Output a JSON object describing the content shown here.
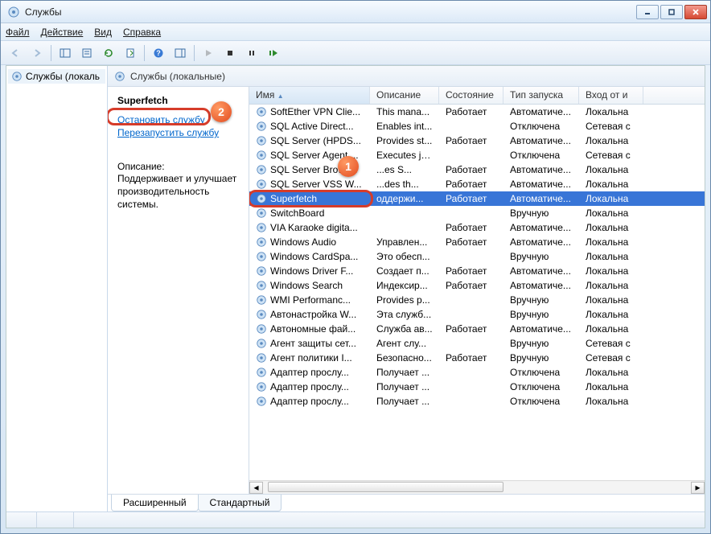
{
  "window": {
    "title": "Службы"
  },
  "menu": {
    "file": "Файл",
    "action": "Действие",
    "view": "Вид",
    "help": "Справка"
  },
  "tree": {
    "root": "Службы (локаль"
  },
  "header": {
    "title": "Службы (локальные)"
  },
  "detail": {
    "name": "Superfetch",
    "stop": "Остановить службу",
    "restart": "Перезапустить службу",
    "desc_label": "Описание:",
    "desc_text": "Поддерживает и улучшает производительность системы."
  },
  "columns": {
    "name": "Имя",
    "desc": "Описание",
    "state": "Состояние",
    "startup": "Тип запуска",
    "logon": "Вход от и"
  },
  "col_widths": {
    "name": 150,
    "desc": 86,
    "state": 80,
    "startup": 94,
    "logon": 80
  },
  "services": [
    {
      "name": "SoftEther VPN Clie...",
      "desc": "This mana...",
      "state": "Работает",
      "startup": "Автоматиче...",
      "logon": "Локальна"
    },
    {
      "name": "SQL Active Direct...",
      "desc": "Enables int...",
      "state": "",
      "startup": "Отключена",
      "logon": "Сетевая с"
    },
    {
      "name": "SQL Server (HPDS...",
      "desc": "Provides st...",
      "state": "Работает",
      "startup": "Автоматиче...",
      "logon": "Локальна"
    },
    {
      "name": "SQL Server Agent ...",
      "desc": "Executes jo...",
      "state": "",
      "startup": "Отключена",
      "logon": "Сетевая с"
    },
    {
      "name": "SQL Server Browser",
      "desc": "...es S...",
      "state": "Работает",
      "startup": "Автоматиче...",
      "logon": "Локальна"
    },
    {
      "name": "SQL Server VSS W...",
      "desc": "...des th...",
      "state": "Работает",
      "startup": "Автоматиче...",
      "logon": "Локальна"
    },
    {
      "name": "Superfetch",
      "desc": "оддержи...",
      "state": "Работает",
      "startup": "Автоматиче...",
      "logon": "Локальна",
      "selected": true
    },
    {
      "name": "SwitchBoard",
      "desc": "",
      "state": "",
      "startup": "Вручную",
      "logon": "Локальна"
    },
    {
      "name": "VIA Karaoke digita...",
      "desc": "",
      "state": "Работает",
      "startup": "Автоматиче...",
      "logon": "Локальна"
    },
    {
      "name": "Windows Audio",
      "desc": "Управлен...",
      "state": "Работает",
      "startup": "Автоматиче...",
      "logon": "Локальна"
    },
    {
      "name": "Windows CardSpa...",
      "desc": "Это обесп...",
      "state": "",
      "startup": "Вручную",
      "logon": "Локальна"
    },
    {
      "name": "Windows Driver F...",
      "desc": "Создает п...",
      "state": "Работает",
      "startup": "Автоматиче...",
      "logon": "Локальна"
    },
    {
      "name": "Windows Search",
      "desc": "Индексир...",
      "state": "Работает",
      "startup": "Автоматиче...",
      "logon": "Локальна"
    },
    {
      "name": "WMI Performanc...",
      "desc": "Provides p...",
      "state": "",
      "startup": "Вручную",
      "logon": "Локальна"
    },
    {
      "name": "Автонастройка W...",
      "desc": "Эта служб...",
      "state": "",
      "startup": "Вручную",
      "logon": "Локальна"
    },
    {
      "name": "Автономные фай...",
      "desc": "Служба ав...",
      "state": "Работает",
      "startup": "Автоматиче...",
      "logon": "Локальна"
    },
    {
      "name": "Агент защиты сет...",
      "desc": "Агент слу...",
      "state": "",
      "startup": "Вручную",
      "logon": "Сетевая с"
    },
    {
      "name": "Агент политики I...",
      "desc": "Безопасно...",
      "state": "Работает",
      "startup": "Вручную",
      "logon": "Сетевая с"
    },
    {
      "name": "Адаптер прослу...",
      "desc": "Получает ...",
      "state": "",
      "startup": "Отключена",
      "logon": "Локальна"
    },
    {
      "name": "Адаптер прослу...",
      "desc": "Получает ...",
      "state": "",
      "startup": "Отключена",
      "logon": "Локальна"
    },
    {
      "name": "Адаптер прослу...",
      "desc": "Получает ...",
      "state": "",
      "startup": "Отключена",
      "logon": "Локальна"
    }
  ],
  "tabs": {
    "extended": "Расширенный",
    "standard": "Стандартный"
  },
  "callouts": {
    "b1": "1",
    "b2": "2"
  }
}
